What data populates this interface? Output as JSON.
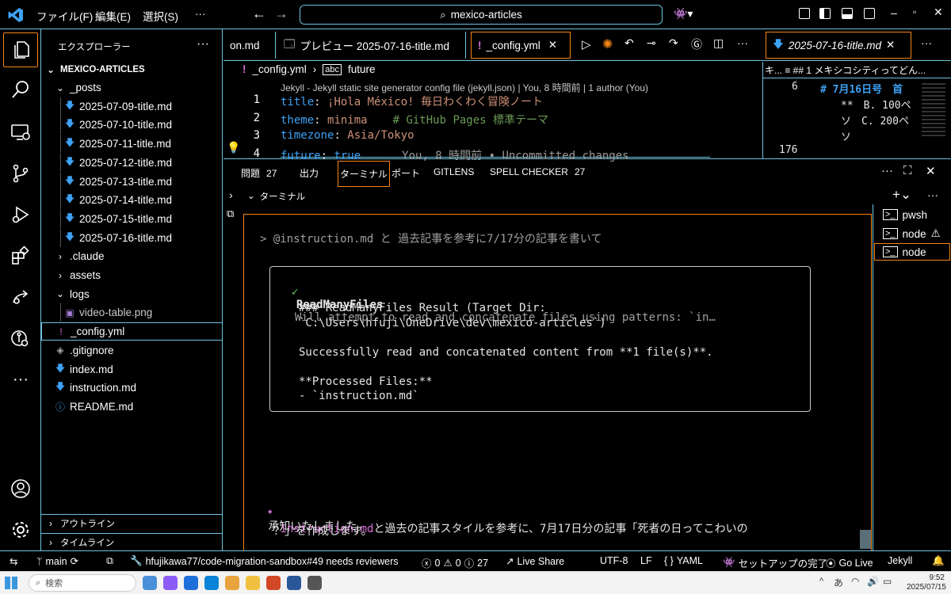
{
  "titlebar": {
    "menus": [
      "ファイル(F)",
      "編集(E)",
      "選択(S)",
      "···"
    ],
    "search": "mexico-articles"
  },
  "sidebar": {
    "title": "エクスプローラー",
    "more": "···",
    "root": "MEXICO-ARTICLES",
    "items": [
      {
        "label": "_posts",
        "type": "folder-open",
        "indent": 1
      },
      {
        "label": "2025-07-09-title.md",
        "type": "md",
        "indent": 2
      },
      {
        "label": "2025-07-10-title.md",
        "type": "md",
        "indent": 2
      },
      {
        "label": "2025-07-11-title.md",
        "type": "md",
        "indent": 2
      },
      {
        "label": "2025-07-12-title.md",
        "type": "md",
        "indent": 2
      },
      {
        "label": "2025-07-13-title.md",
        "type": "md",
        "indent": 2
      },
      {
        "label": "2025-07-14-title.md",
        "type": "md",
        "indent": 2
      },
      {
        "label": "2025-07-15-title.md",
        "type": "md",
        "indent": 2
      },
      {
        "label": "2025-07-16-title.md",
        "type": "md",
        "indent": 2
      },
      {
        "label": ".claude",
        "type": "folder",
        "indent": 1
      },
      {
        "label": "assets",
        "type": "folder",
        "indent": 1
      },
      {
        "label": "logs",
        "type": "folder-open",
        "indent": 1
      },
      {
        "label": "video-table.png",
        "type": "png",
        "indent": 2
      },
      {
        "label": "_config.yml",
        "type": "yml",
        "indent": 1
      },
      {
        "label": ".gitignore",
        "type": "git",
        "indent": 1
      },
      {
        "label": "index.md",
        "type": "md",
        "indent": 1
      },
      {
        "label": "instruction.md",
        "type": "md",
        "indent": 1
      },
      {
        "label": "README.md",
        "type": "info",
        "indent": 1
      }
    ],
    "outline": "アウトライン",
    "timeline": "タイムライン"
  },
  "tabs": [
    "on.md",
    "プレビュー 2025-07-16-title.md",
    "_config.yml",
    "2025-07-16-title.md"
  ],
  "breadcrumb": {
    "file": "_config.yml",
    "item": "future"
  },
  "codelens": "Jekyll - Jekyll static site generator config file (jekyll.json) | You, 8 時間前 | 1 author (You)",
  "code": [
    {
      "n": "1",
      "key": "title",
      "val": "¡Hola México! 毎日わくわく冒険ノート",
      "comment": ""
    },
    {
      "n": "2",
      "key": "theme",
      "val": "minima",
      "comment": "# GitHub Pages 標準テーマ"
    },
    {
      "n": "3",
      "key": "timezone",
      "val": "Asia/Tokyo",
      "comment": ""
    },
    {
      "n": "4",
      "key": "future",
      "val": "true",
      "comment": "You, 8 時間前 • Uncommitted changes"
    }
  ],
  "preview": {
    "crumb": "キ... ≡ ## 1 メキシコシティってどん...",
    "line6": "6",
    "head": "# 7月16日号　首",
    "l1": "**　B. 100ペ",
    "l2": "ソ　C. 200ペ",
    "l3": "ソ",
    "n176": "176"
  },
  "panel": {
    "tabs": [
      {
        "label": "問題",
        "badge": "27"
      },
      {
        "label": "出力",
        "badge": ""
      },
      {
        "label": "ターミナル",
        "badge": ""
      },
      {
        "label": "ポート",
        "badge": ""
      },
      {
        "label": "GITLENS",
        "badge": ""
      },
      {
        "label": "SPELL CHECKER",
        "badge": "27"
      }
    ],
    "section": "ターミナル"
  },
  "terminal": {
    "prompt": "> @instruction.md と 過去記事を参考に7/17分の記事を書いて",
    "tool_name": "ReadManyFiles",
    "tool_desc": "Will attempt to read and concatenate files using patterns: `in…",
    "lines": [
      "### ReadManyFiles Result (Target Dir:",
      "`C:\\Users\\hfuji\\OneDrive\\dev\\mexico-articles`)",
      "",
      "Successfully read and concatenated content from **1 file(s)**.",
      "",
      "**Processed Files:**",
      "- `instruction.md`"
    ],
    "reply1": "承知いたしました。",
    "reply_link": "instruction.md",
    "reply2": "と過去の記事スタイルを参考に、7月17日分の記事「死者の日ってこわいの",
    "reply3": "？」を作成します。"
  },
  "terminals": [
    "pwsh",
    "node",
    "node"
  ],
  "status": {
    "branch": "main",
    "pr": "hfujikawa77/code-migration-sandbox#49 needs reviewers",
    "errors": "0",
    "warnings": "0",
    "infos": "27",
    "liveshare": "Live Share",
    "encoding": "UTF-8",
    "eol": "LF",
    "lang": "YAML",
    "setup": "セットアップの完了",
    "golive": "Go Live",
    "jekyll": "Jekyll"
  },
  "taskbar": {
    "search": "検索",
    "ime": "あ",
    "time": "9:52",
    "date": "2025/07/15"
  }
}
